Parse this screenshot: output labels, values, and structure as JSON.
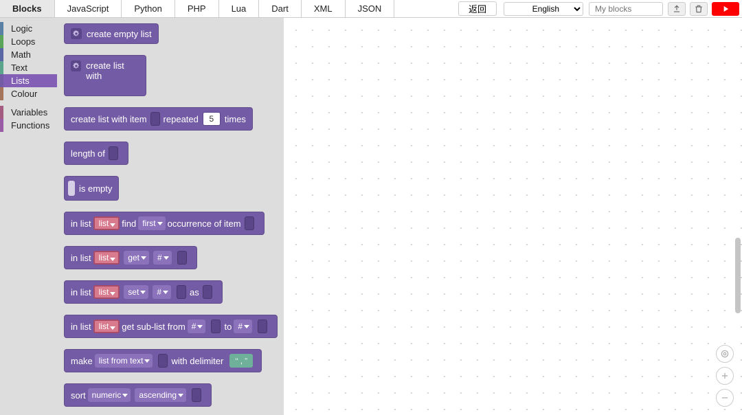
{
  "tabs": [
    "Blocks",
    "JavaScript",
    "Python",
    "PHP",
    "Lua",
    "Dart",
    "XML",
    "JSON"
  ],
  "active_tab": "Blocks",
  "toolbar": {
    "back": "返回",
    "language": "English",
    "myblocks_placeholder": "My blocks"
  },
  "categories": [
    {
      "name": "Logic",
      "color": "#5b80a5"
    },
    {
      "name": "Loops",
      "color": "#5ba55b"
    },
    {
      "name": "Math",
      "color": "#5b67a5"
    },
    {
      "name": "Text",
      "color": "#5ba58c"
    },
    {
      "name": "Lists",
      "color": "#745ba5",
      "selected": true
    },
    {
      "name": "Colour",
      "color": "#a5745b"
    },
    {
      "name": "Variables",
      "color": "#a55b80"
    },
    {
      "name": "Functions",
      "color": "#995ba5"
    }
  ],
  "blocks": {
    "create_empty": "create empty list",
    "create_with": "create list with",
    "repeat_item": "create list with item",
    "repeat_mid": "repeated",
    "repeat_times": "times",
    "repeat_count": "5",
    "length": "length of",
    "is_empty": "is empty",
    "in_list": "in list",
    "var_list": "list",
    "find": "find",
    "first": "first",
    "occurrence": "occurrence of item",
    "get": "get",
    "hash": "#",
    "set": "set",
    "as": "as",
    "sublist": "get sub-list from",
    "to": "to",
    "make": "make",
    "list_from_text": "list from text",
    "with_delimiter": "with delimiter",
    "delimiter_value": ",",
    "sort": "sort",
    "numeric": "numeric",
    "ascending": "ascending"
  }
}
